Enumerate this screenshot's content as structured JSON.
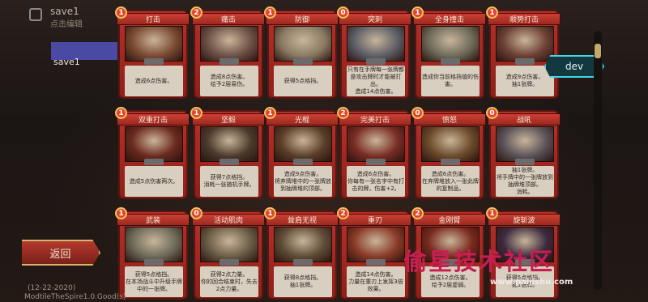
{
  "save": {
    "title": "save1",
    "subtitle": "点击编辑",
    "label": "save1"
  },
  "back_button": "返回",
  "dev_button": "dev",
  "footer": {
    "date": "(12-22-2020)",
    "mod": "ModtileTheSpire1.0.Good(s)"
  },
  "watermark": {
    "text": "偷星技术社区",
    "url": "www.paijishu.com"
  },
  "art_colors": [
    "#7b4a32",
    "#6d5146",
    "#8a7a63",
    "#5d5f67",
    "#6f6b5a",
    "#6c4034",
    "#6b2a1e",
    "#4c3a2c",
    "#5b3e28",
    "#7a2d24",
    "#6b4a2a",
    "#5a5258",
    "#6d6a5a",
    "#6a5c45",
    "#5e4b36",
    "#8a3a26",
    "#7a2a1e",
    "#3c2a3e"
  ],
  "cards": [
    {
      "cost": "1",
      "name": "打击",
      "desc": "造成6点伤害。"
    },
    {
      "cost": "2",
      "name": "痛击",
      "desc": "造成8点伤害。\n给予2层易伤。"
    },
    {
      "cost": "1",
      "name": "防御",
      "desc": "获得5点格挡。"
    },
    {
      "cost": "0",
      "name": "突刺",
      "desc": "只有在手牌每一张牌都是攻击牌时才能被打出。\n造成14点伤害。"
    },
    {
      "cost": "1",
      "name": "全身撞击",
      "desc": "造成你当前格挡值的伤害。"
    },
    {
      "cost": "1",
      "name": "顺势打击",
      "desc": "造成9点伤害。\n抽1张牌。"
    },
    {
      "cost": "1",
      "name": "双重打击",
      "desc": "造成5点伤害两次。"
    },
    {
      "cost": "1",
      "name": "坚毅",
      "desc": "获得7点格挡。\n消耗一张随机手牌。"
    },
    {
      "cost": "1",
      "name": "光棍",
      "desc": "造成9点伤害。\n将弃牌堆中的一张牌放到抽牌堆的顶部。"
    },
    {
      "cost": "2",
      "name": "完美打击",
      "desc": "造成6点伤害。\n你每有一张名字中有打击的牌，伤害+2。"
    },
    {
      "cost": "0",
      "name": "愤怒",
      "desc": "造成6点伤害。\n在弃牌堆放入一张此牌的复制品。"
    },
    {
      "cost": "0",
      "name": "战吼",
      "desc": "抽1张牌。\n将手牌中的一张牌放到抽牌堆顶部。\n消耗。"
    },
    {
      "cost": "1",
      "name": "武装",
      "desc": "获得5点格挡。\n在本场战斗中升级手牌中的一张牌。"
    },
    {
      "cost": "0",
      "name": "活动肌肉",
      "desc": "获得2点力量。\n你的回合结束时，失去2点力量。"
    },
    {
      "cost": "1",
      "name": "耸肩无视",
      "desc": "获得8点格挡。\n抽1张牌。"
    },
    {
      "cost": "2",
      "name": "重刃",
      "desc": "造成14点伤害。\n力量在重刃上发挥3倍效果。"
    },
    {
      "cost": "2",
      "name": "金刚臂",
      "desc": "造成12点伤害。\n给予2层虚弱。"
    },
    {
      "cost": "1",
      "name": "旋斩波",
      "desc": "获得5点格挡。\n抽1张牌。"
    }
  ]
}
